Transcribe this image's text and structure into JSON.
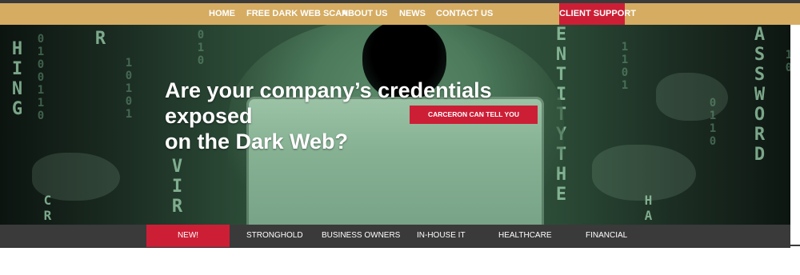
{
  "topnav": {
    "items": [
      {
        "label": "HOME",
        "has_dropdown": false
      },
      {
        "label": "FREE DARK WEB SCAN",
        "has_dropdown": false
      },
      {
        "label": "ABOUT US",
        "has_dropdown": true
      },
      {
        "label": "NEWS",
        "has_dropdown": false
      },
      {
        "label": "CONTACT US",
        "has_dropdown": true
      }
    ],
    "client_support_label": "CLIENT SUPPORT",
    "caret_glyph": "ˇ"
  },
  "hero": {
    "headline_line1": "Are your company’s credentials exposed",
    "headline_line2": "on the Dark Web?",
    "cta_label": "CARCERON CAN TELL YOU",
    "matrix_text": {
      "col_a": "HING",
      "col_b": "R",
      "col_c": "VIR",
      "col_d": "ENTITYTHE",
      "col_e": "ASSWORD",
      "col_f": "CR",
      "col_g": "HA"
    }
  },
  "subnav": {
    "items": [
      {
        "label": "NEW!",
        "active": true
      },
      {
        "label": "STRONGHOLD",
        "active": false
      },
      {
        "label": "BUSINESS OWNERS",
        "active": false
      },
      {
        "label": "IN-HOUSE IT",
        "active": false
      },
      {
        "label": "HEALTHCARE",
        "active": false
      },
      {
        "label": "FINANCIAL",
        "active": false
      }
    ]
  },
  "colors": {
    "gold": "#d5ac62",
    "accent_red": "#cc1f36",
    "dark_bar": "#3a3a3a"
  }
}
